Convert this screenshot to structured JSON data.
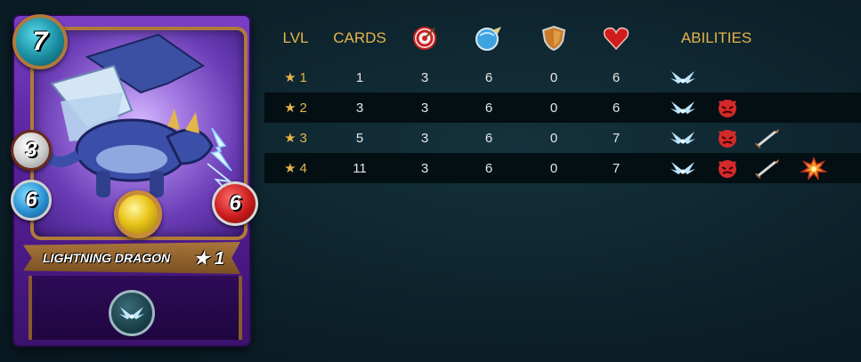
{
  "card": {
    "name": "LIGHTNING DRAGON",
    "level_label": "★ 1",
    "mana": "7",
    "ranged": "3",
    "speed": "6",
    "health": "6",
    "ability_icon": "flying-icon"
  },
  "table": {
    "headers": {
      "lvl": "LVL",
      "cards": "CARDS",
      "ranged_icon": "ranged-attack-icon",
      "speed_icon": "speed-icon",
      "armor_icon": "armor-shield-icon",
      "health_icon": "health-heart-icon",
      "abilities": "ABILITIES"
    },
    "rows": [
      {
        "star": "★",
        "lvl": "1",
        "cards": "1",
        "ranged": "3",
        "speed": "6",
        "armor": "0",
        "health": "6",
        "abilities": [
          "flying-icon"
        ]
      },
      {
        "star": "★",
        "lvl": "2",
        "cards": "3",
        "ranged": "3",
        "speed": "6",
        "armor": "0",
        "health": "6",
        "abilities": [
          "flying-icon",
          "enrage-icon"
        ]
      },
      {
        "star": "★",
        "lvl": "3",
        "cards": "5",
        "ranged": "3",
        "speed": "6",
        "armor": "0",
        "health": "7",
        "abilities": [
          "flying-icon",
          "enrage-icon",
          "snipe-icon"
        ]
      },
      {
        "star": "★",
        "lvl": "4",
        "cards": "11",
        "ranged": "3",
        "speed": "6",
        "armor": "0",
        "health": "7",
        "abilities": [
          "flying-icon",
          "enrage-icon",
          "snipe-icon",
          "blast-icon"
        ]
      }
    ]
  },
  "colors": {
    "header_gold": "#e5b54a",
    "background": "#0c2029",
    "card_purple": "#5a23a0"
  }
}
